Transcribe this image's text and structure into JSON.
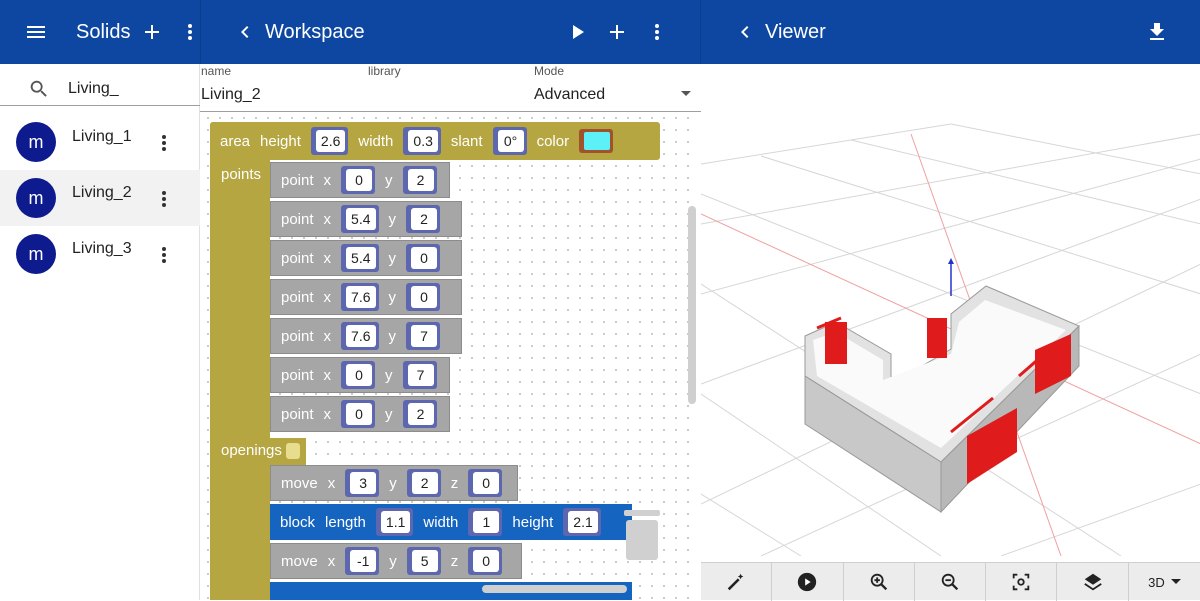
{
  "solids_panel": {
    "title": "Solids",
    "search_value": "Living_",
    "items": [
      {
        "avatar": "m",
        "label": "Living_1"
      },
      {
        "avatar": "m",
        "label": "Living_2"
      },
      {
        "avatar": "m",
        "label": "Living_3"
      }
    ]
  },
  "workspace_panel": {
    "title": "Workspace",
    "fields": {
      "name_label": "name",
      "name_value": "Living_2",
      "library_label": "library",
      "mode_label": "Mode",
      "mode_value": "Advanced"
    },
    "area_block": {
      "kw": "area",
      "height_label": "height",
      "height": "2.6",
      "width_label": "width",
      "width": "0.3",
      "slant_label": "slant",
      "slant": "0°",
      "color_label": "color",
      "color": "#5ef0f7"
    },
    "points_label": "points",
    "points": [
      {
        "kw": "point",
        "x": "0",
        "y": "2"
      },
      {
        "kw": "point",
        "x": "5.4",
        "y": "2"
      },
      {
        "kw": "point",
        "x": "5.4",
        "y": "0"
      },
      {
        "kw": "point",
        "x": "7.6",
        "y": "0"
      },
      {
        "kw": "point",
        "x": "7.6",
        "y": "7"
      },
      {
        "kw": "point",
        "x": "0",
        "y": "7"
      },
      {
        "kw": "point",
        "x": "0",
        "y": "2"
      }
    ],
    "openings_label": "openings",
    "openings": [
      {
        "kw": "move",
        "x": "3",
        "y": "2",
        "z": "0"
      },
      {
        "kw": "block",
        "length_label": "length",
        "length": "1.1",
        "width_label": "width",
        "width": "1",
        "height_label": "height",
        "height": "2.1"
      },
      {
        "kw": "move",
        "x": "-1",
        "y": "5",
        "z": "0"
      }
    ]
  },
  "viewer_panel": {
    "title": "Viewer",
    "view_mode": "3D",
    "toolbar_icons": [
      "magic-wand-icon",
      "play-circle-icon",
      "zoom-in-icon",
      "zoom-out-icon",
      "center-focus-icon",
      "layers-icon"
    ]
  },
  "colors": {
    "appbar": "#0d47a1",
    "block_gold": "#b5a642",
    "block_gray": "#a6a6a6",
    "block_blue": "#1565c0",
    "avatar": "#0d1b8f",
    "opening_red": "#e01b1b"
  }
}
